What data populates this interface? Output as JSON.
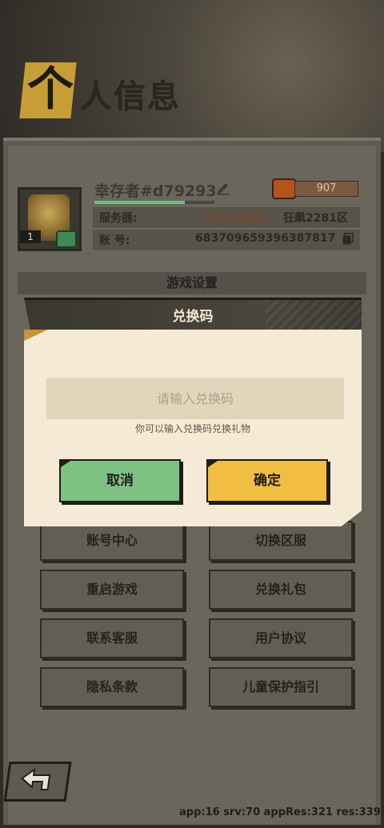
{
  "page": {
    "title_first_char": "个",
    "title_rest": "人信息"
  },
  "profile": {
    "name": "幸存者#d79293",
    "level": "1",
    "exp_fraction": 0.75,
    "power": "907",
    "server_label": "服务器:",
    "server_zone": "[第115战区]",
    "server_name": "狂飙2281区",
    "account_label": "账    号:",
    "account_id": "683709659396387817"
  },
  "settings": {
    "section_title": "游戏设置",
    "buttons": [
      {
        "label": "账号中心"
      },
      {
        "label": "切换区服"
      },
      {
        "label": "重启游戏"
      },
      {
        "label": "兑换礼包"
      },
      {
        "label": "联系客服"
      },
      {
        "label": "用户协议"
      },
      {
        "label": "隐私条款"
      },
      {
        "label": "儿童保护指引"
      }
    ]
  },
  "dialog": {
    "title": "兑换码",
    "input_placeholder": "请输入兑换码",
    "input_value": "",
    "hint": "你可以输入兑换码兑换礼物",
    "cancel_label": "取消",
    "confirm_label": "确定"
  },
  "debug": {
    "text": "app:16 srv:70 appRes:321 res:339"
  },
  "colors": {
    "accent_gold": "#c79d35",
    "cancel_green": "#7ec183",
    "confirm_yellow": "#f1be42",
    "dialog_bg": "#f5ead5"
  },
  "icons": [
    "edit-icon",
    "fist-icon",
    "copy-icon",
    "back-arrow-icon",
    "gender-icon"
  ]
}
